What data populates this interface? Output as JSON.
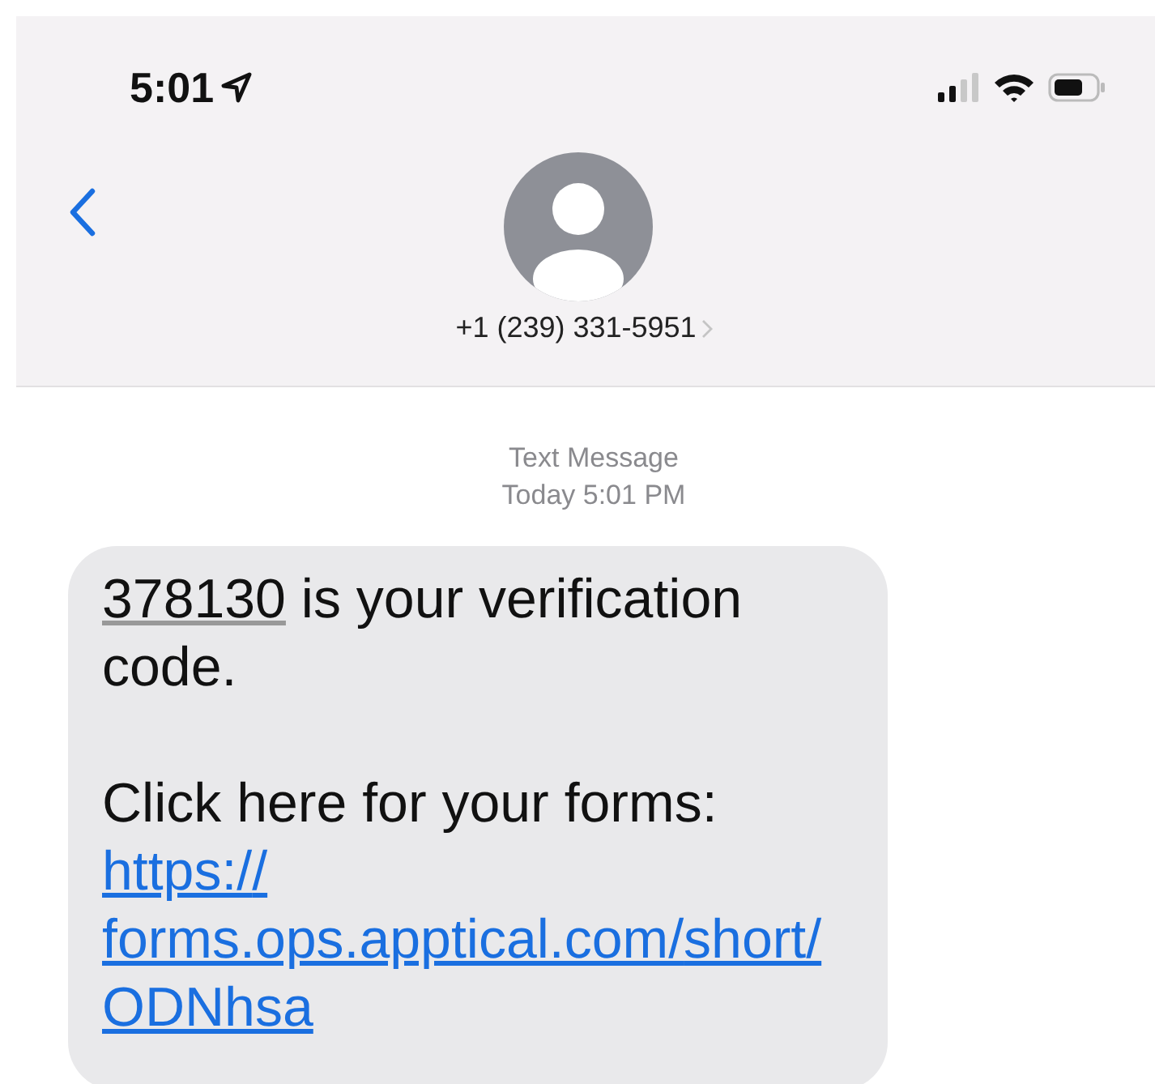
{
  "status_bar": {
    "time": "5:01"
  },
  "header": {
    "phone_number": "+1 (239) 331-5951"
  },
  "conversation": {
    "label": "Text Message",
    "timestamp": "Today 5:01 PM"
  },
  "messages": [
    {
      "paragraphs": [
        {
          "segments": [
            {
              "kind": "code",
              "text": "378130"
            },
            {
              "kind": "text",
              "text": " is your verification code."
            }
          ]
        },
        {
          "segments": [
            {
              "kind": "text",
              "text": "Click here for your forms:"
            },
            {
              "kind": "link",
              "text": "https://forms.ops.apptical.com/short/ODNhsa"
            }
          ]
        }
      ]
    }
  ]
}
